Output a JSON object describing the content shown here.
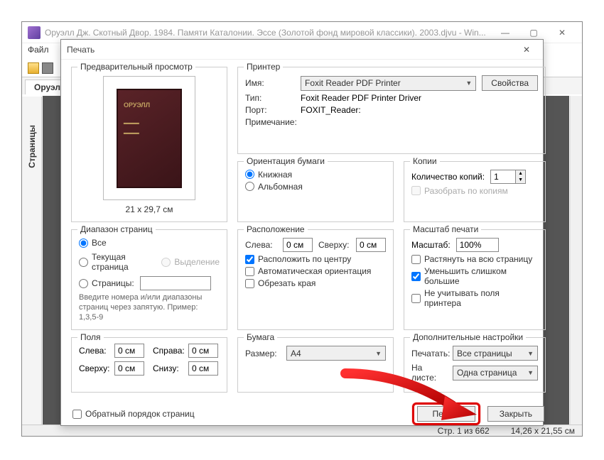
{
  "main": {
    "title": "Оруэлл Дж. Скотный Двор. 1984. Памяти Каталонии. Эссе (Золотой фонд мировой классики). 2003.djvu - Win...",
    "menu_file": "Файл",
    "tab_label": "Оруэлл",
    "side_label": "Страницы",
    "status_pages": "Стр. 1 из 662",
    "status_size": "14,26 x 21,55 см"
  },
  "dialog": {
    "title": "Печать",
    "preview": {
      "group": "Предварительный просмотр",
      "dimensions": "21 x 29,7 см",
      "book_title": "ОРУЭЛЛ"
    },
    "printer": {
      "group": "Принтер",
      "name_lbl": "Имя:",
      "name_val": "Foxit Reader PDF Printer",
      "props_btn": "Свойства",
      "type_lbl": "Тип:",
      "type_val": "Foxit Reader PDF Printer Driver",
      "port_lbl": "Порт:",
      "port_val": "FOXIT_Reader:",
      "note_lbl": "Примечание:"
    },
    "orient": {
      "group": "Ориентация бумаги",
      "portrait": "Книжная",
      "landscape": "Альбомная"
    },
    "copies": {
      "group": "Копии",
      "count_lbl": "Количество копий:",
      "count_val": "1",
      "collate": "Разобрать по копиям"
    },
    "range": {
      "group": "Диапазон страниц",
      "all": "Все",
      "current": "Текущая страница",
      "selection": "Выделение",
      "pages": "Страницы:",
      "pages_val": "",
      "hint": "Введите номера и/или диапазоны страниц через запятую. Пример: 1,3,5-9"
    },
    "layout": {
      "group": "Расположение",
      "left_lbl": "Слева:",
      "left_val": "0 см",
      "top_lbl": "Сверху:",
      "top_val": "0 см",
      "center": "Расположить по центру",
      "autoorient": "Автоматическая ориентация",
      "crop": "Обрезать края"
    },
    "scale": {
      "group": "Масштаб печати",
      "scale_lbl": "Масштаб:",
      "scale_val": "100%",
      "stretch": "Растянуть на всю страницу",
      "shrink": "Уменьшить слишком большие",
      "ignore_margins": "Не учитывать поля принтера"
    },
    "margins": {
      "group": "Поля",
      "left_lbl": "Слева:",
      "left_val": "0 см",
      "right_lbl": "Справа:",
      "right_val": "0 см",
      "top_lbl": "Сверху:",
      "top_val": "0 см",
      "bottom_lbl": "Снизу:",
      "bottom_val": "0 см"
    },
    "paper": {
      "group": "Бумага",
      "size_lbl": "Размер:",
      "size_val": "A4"
    },
    "extra": {
      "group": "Дополнительные настройки",
      "print_lbl": "Печатать:",
      "print_val": "Все страницы",
      "sheet_lbl": "На листе:",
      "sheet_val": "Одна страница"
    },
    "reverse": "Обратный порядок страниц",
    "print_btn": "Печать",
    "close_btn": "Закрыть"
  }
}
